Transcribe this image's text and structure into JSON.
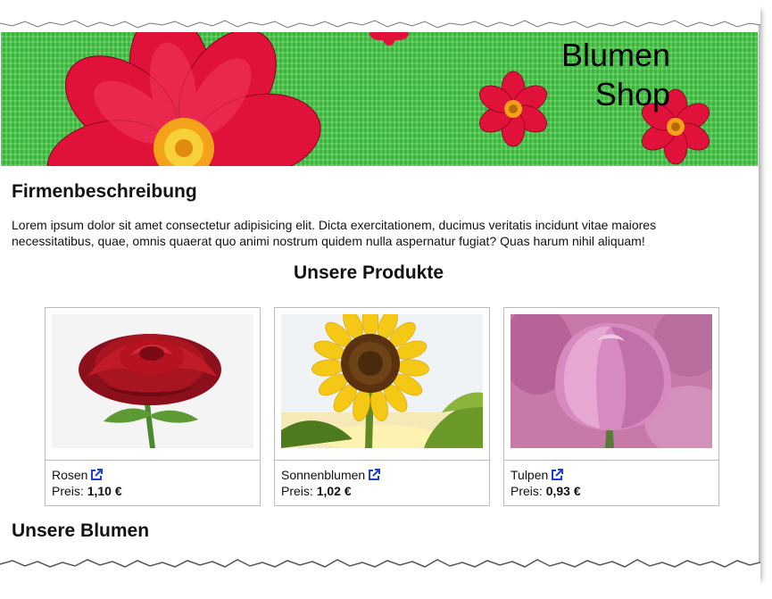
{
  "header": {
    "title_line1": "Blumen",
    "title_line2": "Shop"
  },
  "company": {
    "heading": "Firmenbeschreibung",
    "description": "Lorem ipsum dolor sit amet consectetur adipisicing elit. Dicta exercitationem, ducimus veritatis incidunt vitae maiores necessitatibus, quae, omnis quaerat quo animi nostrum quidem nulla aspernatur fugiat? Quas harum nihil aliquam!"
  },
  "products": {
    "heading": "Unsere Produkte",
    "price_label": "Preis:",
    "items": [
      {
        "name": "Rosen",
        "price": "1,10 €",
        "icon": "external-link-icon"
      },
      {
        "name": "Sonnenblumen",
        "price": "1,02 €",
        "icon": "external-link-icon"
      },
      {
        "name": "Tulpen",
        "price": "0,93 €",
        "icon": "external-link-icon"
      }
    ]
  },
  "flowers": {
    "heading": "Unsere Blumen"
  },
  "colors": {
    "banner_green": "#49c94a",
    "flower_red": "#e0123a",
    "link_blue": "#1a3fd6"
  }
}
